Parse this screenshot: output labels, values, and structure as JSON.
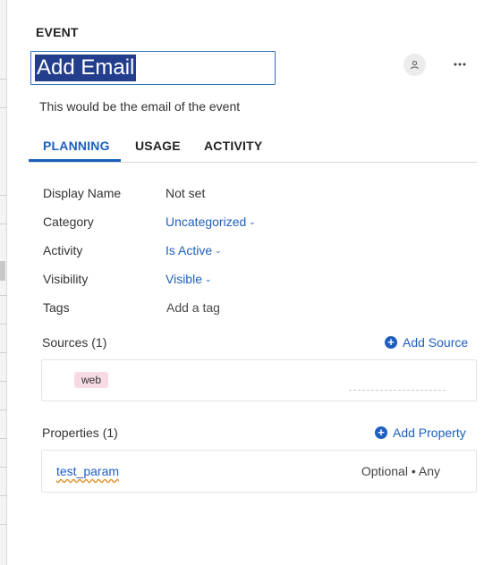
{
  "header": {
    "kind_label": "EVENT",
    "title_value": "Add Email",
    "description": "This would be the email of the event",
    "user_icon": "user-icon",
    "more_icon": "more-horizontal-icon"
  },
  "tabs": [
    {
      "label": "PLANNING",
      "active": true
    },
    {
      "label": "USAGE",
      "active": false
    },
    {
      "label": "ACTIVITY",
      "active": false
    }
  ],
  "fields": [
    {
      "label": "Display Name",
      "value": "Not set",
      "style": "plain"
    },
    {
      "label": "Category",
      "value": "Uncategorized",
      "style": "link-dropdown"
    },
    {
      "label": "Activity",
      "value": "Is Active",
      "style": "link-dropdown"
    },
    {
      "label": "Visibility",
      "value": "Visible",
      "style": "link-dropdown"
    },
    {
      "label": "Tags",
      "value": "Add a tag",
      "style": "placeholder"
    }
  ],
  "sources": {
    "title": "Sources (1)",
    "add_label": "Add Source",
    "items": [
      {
        "name": "web"
      }
    ]
  },
  "properties": {
    "title": "Properties (1)",
    "add_label": "Add Property",
    "items": [
      {
        "name": "test_param",
        "meta": "Optional • Any"
      }
    ]
  },
  "colors": {
    "accent": "#1d5fbf",
    "selection": "#233e8c",
    "chip_bg": "#f7dbe4"
  }
}
